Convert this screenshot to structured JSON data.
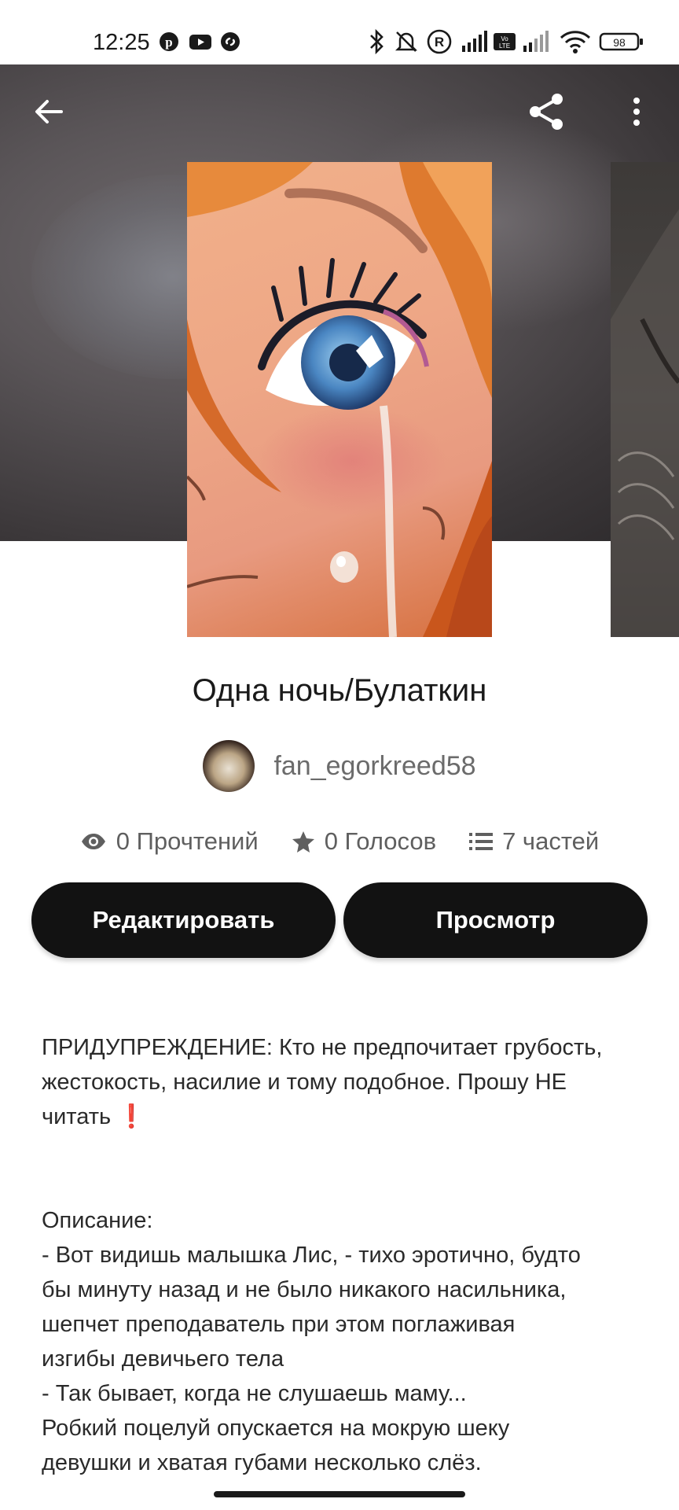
{
  "status_bar": {
    "time": "12:25",
    "battery": "98",
    "left_icons": [
      "pinterest-icon",
      "youtube-icon",
      "shazam-icon"
    ],
    "right_icons": [
      "bluetooth-icon",
      "bell-off-icon",
      "r-icon",
      "signal-icon",
      "volte-icon",
      "signal-icon",
      "wifi-icon",
      "battery-icon"
    ]
  },
  "toolbar": {
    "back_icon": "arrow-left-icon",
    "share_icon": "share-icon",
    "menu_icon": "more-vertical-icon"
  },
  "story": {
    "title": "Одна ночь/Булаткин",
    "author": "fan_egorkreed58"
  },
  "stats": {
    "reads": "0 Прочтений",
    "votes": "0 Голосов",
    "parts": "7 частей"
  },
  "buttons": {
    "edit": "Редактировать",
    "preview": "Просмотр"
  },
  "description": {
    "warning_line1": "ПРИДУПРЕЖДЕНИЕ: Кто не предпочитает грубость,",
    "warning_line2": "жестокость, насилие и тому подобное. Прошу НЕ",
    "warning_line3": "читать",
    "warning_emoji": "❗",
    "lines": [
      "Описание:",
      "- Вот видишь малышка Лис, - тихо эротично, будто",
      "бы минуту назад и не было никакого насильника,",
      "шепчет преподаватель при этом поглаживая",
      "изгибы девичьего тела",
      "- Так бывает, когда не слушаешь маму...",
      "Робкий поцелуй опускается на мокрую шеку",
      "девушки и хватая губами несколько слёз."
    ]
  },
  "colors": {
    "button_bg": "#121212",
    "button_text": "#ffffff",
    "accent_warning": "#e53935"
  }
}
